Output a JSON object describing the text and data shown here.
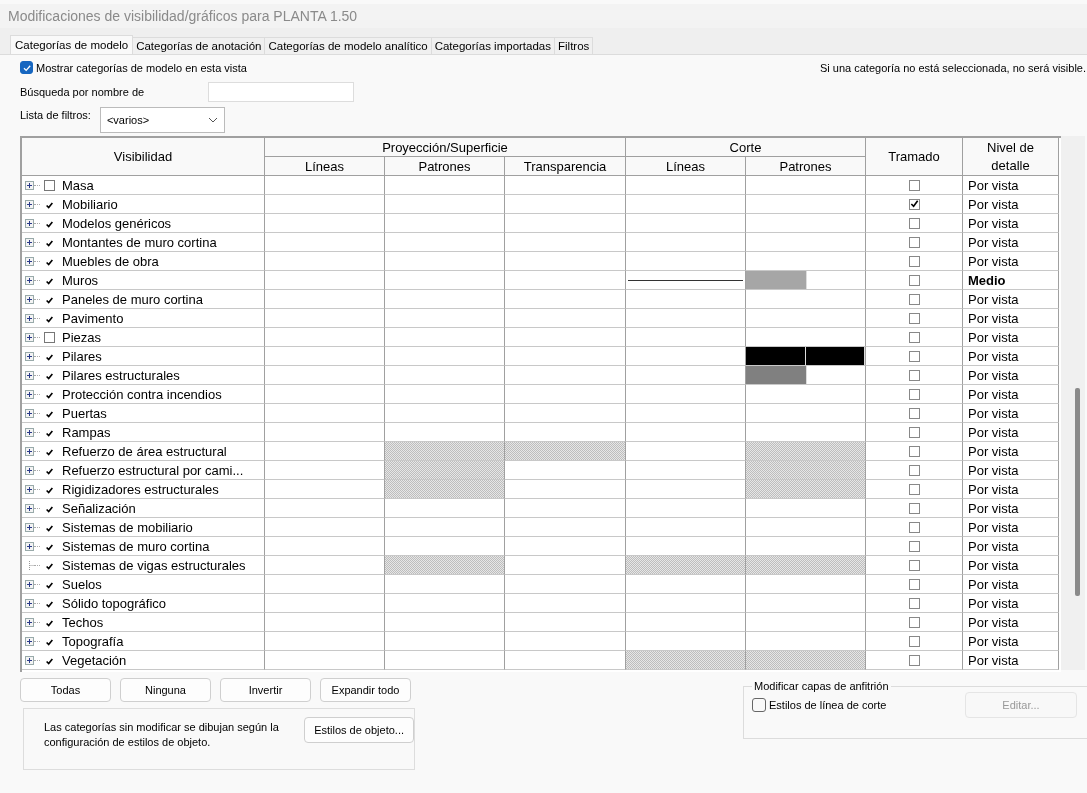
{
  "window": {
    "title": "Modificaciones de visibilidad/gráficos para PLANTA 1.50"
  },
  "tabs": [
    {
      "label": "Categorías de modelo",
      "selected": true
    },
    {
      "label": "Categorías de anotación",
      "selected": false
    },
    {
      "label": "Categorías de modelo analítico",
      "selected": false
    },
    {
      "label": "Categorías importadas",
      "selected": false
    },
    {
      "label": "Filtros",
      "selected": false
    }
  ],
  "show_categories": {
    "label": "Mostrar categorías de modelo en esta vista",
    "checked": true
  },
  "hint": "Si una categoría no está seleccionada, no será visible.",
  "search": {
    "label": "Búsqueda por nombre de"
  },
  "filter_list": {
    "label": "Lista de filtros:",
    "value": "<varios>"
  },
  "table": {
    "headers": {
      "visibility": "Visibilidad",
      "projection": "Proyección/Superficie",
      "cut": "Corte",
      "halftone": "Tramado",
      "detail": "Nivel de detalle",
      "projection_sub": [
        "Líneas",
        "Patrones",
        "Transparencia"
      ],
      "cut_sub": [
        "Líneas",
        "Patrones"
      ]
    },
    "rows": [
      {
        "name": "Masa",
        "expandable": true,
        "visible": false,
        "cells": [
          {
            "kind": "empty"
          },
          {
            "kind": "empty"
          },
          {
            "kind": "empty"
          },
          {
            "kind": "empty"
          },
          {
            "kind": "empty"
          }
        ],
        "halftone": false,
        "detail": "Por vista",
        "overridden": false
      },
      {
        "name": "Mobiliario",
        "expandable": true,
        "visible": true,
        "cells": [
          {
            "kind": "empty"
          },
          {
            "kind": "empty"
          },
          {
            "kind": "empty"
          },
          {
            "kind": "empty"
          },
          {
            "kind": "empty"
          }
        ],
        "halftone": true,
        "detail": "Por vista",
        "overridden": false
      },
      {
        "name": "Modelos genéricos",
        "expandable": true,
        "visible": true,
        "cells": [
          {
            "kind": "empty"
          },
          {
            "kind": "empty"
          },
          {
            "kind": "empty"
          },
          {
            "kind": "empty"
          },
          {
            "kind": "empty"
          }
        ],
        "halftone": false,
        "detail": "Por vista",
        "overridden": false
      },
      {
        "name": "Montantes de muro cortina",
        "expandable": true,
        "visible": true,
        "cells": [
          {
            "kind": "empty"
          },
          {
            "kind": "empty"
          },
          {
            "kind": "empty"
          },
          {
            "kind": "empty"
          },
          {
            "kind": "empty"
          }
        ],
        "halftone": false,
        "detail": "Por vista",
        "overridden": false
      },
      {
        "name": "Muebles de obra",
        "expandable": true,
        "visible": true,
        "cells": [
          {
            "kind": "empty"
          },
          {
            "kind": "empty"
          },
          {
            "kind": "empty"
          },
          {
            "kind": "empty"
          },
          {
            "kind": "empty"
          }
        ],
        "halftone": false,
        "detail": "Por vista",
        "overridden": false
      },
      {
        "name": "Muros",
        "expandable": true,
        "visible": true,
        "cells": [
          {
            "kind": "empty"
          },
          {
            "kind": "empty"
          },
          {
            "kind": "empty"
          },
          {
            "kind": "line"
          },
          {
            "kind": "swatch",
            "swatches": [
              {
                "color": "#a6a6a6"
              }
            ]
          }
        ],
        "halftone": false,
        "detail": "Medio",
        "overridden": true
      },
      {
        "name": "Paneles de muro cortina",
        "expandable": true,
        "visible": true,
        "cells": [
          {
            "kind": "empty"
          },
          {
            "kind": "empty"
          },
          {
            "kind": "empty"
          },
          {
            "kind": "empty"
          },
          {
            "kind": "empty"
          }
        ],
        "halftone": false,
        "detail": "Por vista",
        "overridden": false
      },
      {
        "name": "Pavimento",
        "expandable": true,
        "visible": true,
        "cells": [
          {
            "kind": "empty"
          },
          {
            "kind": "empty"
          },
          {
            "kind": "empty"
          },
          {
            "kind": "empty"
          },
          {
            "kind": "empty"
          }
        ],
        "halftone": false,
        "detail": "Por vista",
        "overridden": false
      },
      {
        "name": "Piezas",
        "expandable": true,
        "visible": false,
        "cells": [
          {
            "kind": "empty"
          },
          {
            "kind": "empty"
          },
          {
            "kind": "empty"
          },
          {
            "kind": "empty"
          },
          {
            "kind": "empty"
          }
        ],
        "halftone": false,
        "detail": "Por vista",
        "overridden": false
      },
      {
        "name": "Pilares",
        "expandable": true,
        "visible": true,
        "cells": [
          {
            "kind": "empty"
          },
          {
            "kind": "empty"
          },
          {
            "kind": "empty"
          },
          {
            "kind": "empty"
          },
          {
            "kind": "swatch",
            "swatches": [
              {
                "color": "#000000"
              },
              {
                "color": "#000000"
              }
            ]
          }
        ],
        "halftone": false,
        "detail": "Por vista",
        "overridden": false
      },
      {
        "name": "Pilares estructurales",
        "expandable": true,
        "visible": true,
        "cells": [
          {
            "kind": "empty"
          },
          {
            "kind": "empty"
          },
          {
            "kind": "empty"
          },
          {
            "kind": "empty"
          },
          {
            "kind": "swatch",
            "swatches": [
              {
                "color": "#808080"
              }
            ]
          }
        ],
        "halftone": false,
        "detail": "Por vista",
        "overridden": false
      },
      {
        "name": "Protección contra incendios",
        "expandable": true,
        "visible": true,
        "cells": [
          {
            "kind": "empty"
          },
          {
            "kind": "empty"
          },
          {
            "kind": "empty"
          },
          {
            "kind": "empty"
          },
          {
            "kind": "empty"
          }
        ],
        "halftone": false,
        "detail": "Por vista",
        "overridden": false
      },
      {
        "name": "Puertas",
        "expandable": true,
        "visible": true,
        "cells": [
          {
            "kind": "empty"
          },
          {
            "kind": "empty"
          },
          {
            "kind": "empty"
          },
          {
            "kind": "empty"
          },
          {
            "kind": "empty"
          }
        ],
        "halftone": false,
        "detail": "Por vista",
        "overridden": false
      },
      {
        "name": "Rampas",
        "expandable": true,
        "visible": true,
        "cells": [
          {
            "kind": "empty"
          },
          {
            "kind": "empty"
          },
          {
            "kind": "empty"
          },
          {
            "kind": "empty"
          },
          {
            "kind": "empty"
          }
        ],
        "halftone": false,
        "detail": "Por vista",
        "overridden": false
      },
      {
        "name": "Refuerzo de área estructural",
        "expandable": true,
        "visible": true,
        "cells": [
          {
            "kind": "empty"
          },
          {
            "kind": "hatched"
          },
          {
            "kind": "hatched"
          },
          {
            "kind": "empty"
          },
          {
            "kind": "hatched"
          }
        ],
        "halftone": false,
        "detail": "Por vista",
        "overridden": false
      },
      {
        "name": "Refuerzo estructural  por cami...",
        "expandable": true,
        "visible": true,
        "cells": [
          {
            "kind": "empty"
          },
          {
            "kind": "hatched"
          },
          {
            "kind": "empty"
          },
          {
            "kind": "empty"
          },
          {
            "kind": "hatched"
          }
        ],
        "halftone": false,
        "detail": "Por vista",
        "overridden": false
      },
      {
        "name": "Rigidizadores estructurales",
        "expandable": true,
        "visible": true,
        "cells": [
          {
            "kind": "empty"
          },
          {
            "kind": "hatched"
          },
          {
            "kind": "empty"
          },
          {
            "kind": "empty"
          },
          {
            "kind": "hatched"
          }
        ],
        "halftone": false,
        "detail": "Por vista",
        "overridden": false
      },
      {
        "name": "Señalización",
        "expandable": true,
        "visible": true,
        "cells": [
          {
            "kind": "empty"
          },
          {
            "kind": "empty"
          },
          {
            "kind": "empty"
          },
          {
            "kind": "empty"
          },
          {
            "kind": "empty"
          }
        ],
        "halftone": false,
        "detail": "Por vista",
        "overridden": false
      },
      {
        "name": "Sistemas de mobiliario",
        "expandable": true,
        "visible": true,
        "cells": [
          {
            "kind": "empty"
          },
          {
            "kind": "empty"
          },
          {
            "kind": "empty"
          },
          {
            "kind": "empty"
          },
          {
            "kind": "empty"
          }
        ],
        "halftone": false,
        "detail": "Por vista",
        "overridden": false
      },
      {
        "name": "Sistemas de muro cortina",
        "expandable": true,
        "visible": true,
        "cells": [
          {
            "kind": "empty"
          },
          {
            "kind": "empty"
          },
          {
            "kind": "empty"
          },
          {
            "kind": "empty"
          },
          {
            "kind": "empty"
          }
        ],
        "halftone": false,
        "detail": "Por vista",
        "overridden": false
      },
      {
        "name": "Sistemas de vigas estructurales",
        "expandable": false,
        "visible": true,
        "cells": [
          {
            "kind": "empty"
          },
          {
            "kind": "hatched"
          },
          {
            "kind": "empty"
          },
          {
            "kind": "hatched"
          },
          {
            "kind": "hatched"
          }
        ],
        "halftone": false,
        "detail": "Por vista",
        "overridden": false
      },
      {
        "name": "Suelos",
        "expandable": true,
        "visible": true,
        "cells": [
          {
            "kind": "empty"
          },
          {
            "kind": "empty"
          },
          {
            "kind": "empty"
          },
          {
            "kind": "empty"
          },
          {
            "kind": "empty"
          }
        ],
        "halftone": false,
        "detail": "Por vista",
        "overridden": false
      },
      {
        "name": "Sólido topográfico",
        "expandable": true,
        "visible": true,
        "cells": [
          {
            "kind": "empty"
          },
          {
            "kind": "empty"
          },
          {
            "kind": "empty"
          },
          {
            "kind": "empty"
          },
          {
            "kind": "empty"
          }
        ],
        "halftone": false,
        "detail": "Por vista",
        "overridden": false
      },
      {
        "name": "Techos",
        "expandable": true,
        "visible": true,
        "cells": [
          {
            "kind": "empty"
          },
          {
            "kind": "empty"
          },
          {
            "kind": "empty"
          },
          {
            "kind": "empty"
          },
          {
            "kind": "empty"
          }
        ],
        "halftone": false,
        "detail": "Por vista",
        "overridden": false
      },
      {
        "name": "Topografía",
        "expandable": true,
        "visible": true,
        "cells": [
          {
            "kind": "empty"
          },
          {
            "kind": "empty"
          },
          {
            "kind": "empty"
          },
          {
            "kind": "empty"
          },
          {
            "kind": "empty"
          }
        ],
        "halftone": false,
        "detail": "Por vista",
        "overridden": false
      },
      {
        "name": "Vegetación",
        "expandable": true,
        "visible": true,
        "cells": [
          {
            "kind": "empty"
          },
          {
            "kind": "empty"
          },
          {
            "kind": "empty"
          },
          {
            "kind": "hatched"
          },
          {
            "kind": "hatched"
          }
        ],
        "halftone": false,
        "detail": "Por vista",
        "overridden": false
      }
    ]
  },
  "buttons": [
    "Todas",
    "Ninguna",
    "Invertir",
    "Expandir todo"
  ],
  "note": {
    "text": "Las categorías sin modificar se dibujan según la configuración de estilos de objeto.",
    "button": "Estilos de objeto..."
  },
  "host_layers": {
    "legend": "Modificar capas de anfitrión",
    "checkbox": {
      "label": "Estilos de línea de corte",
      "checked": false
    },
    "button": {
      "label": "Editar...",
      "disabled": true
    }
  }
}
